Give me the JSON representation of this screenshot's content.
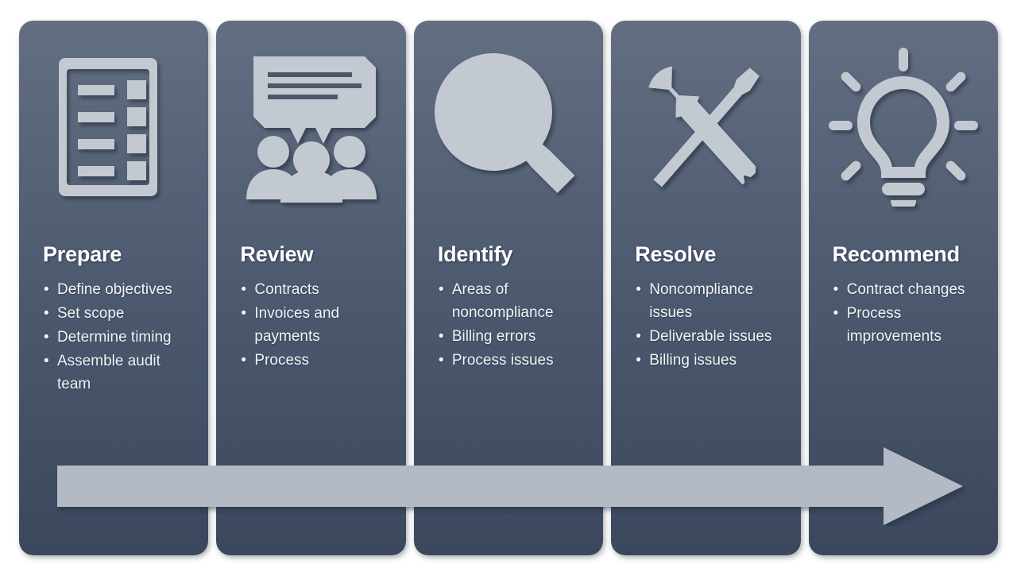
{
  "slide": {
    "background_color": "#ffffff",
    "card_gradient_top": "#636e81",
    "card_gradient_bottom": "#3a475d",
    "icon_color": "#c3c9d1",
    "text_color": "#f2f4f7",
    "title_color": "#ffffff",
    "arrow_color": "#b4bac4"
  },
  "process": {
    "steps": [
      {
        "id": "prepare",
        "title": "Prepare",
        "icon": "checklist-icon",
        "bullets": [
          "Define objectives",
          "Set scope",
          "Determine timing",
          "Assemble audit team"
        ]
      },
      {
        "id": "review",
        "title": "Review",
        "icon": "discussion-group-icon",
        "bullets": [
          "Contracts",
          "Invoices and payments",
          "Process"
        ]
      },
      {
        "id": "identify",
        "title": "Identify",
        "icon": "magnifying-glass-icon",
        "bullets": [
          "Areas of noncompliance",
          "Billing errors",
          "Process issues"
        ]
      },
      {
        "id": "resolve",
        "title": "Resolve",
        "icon": "tools-wrench-screwdriver-icon",
        "bullets": [
          "Noncompliance issues",
          "Deliverable issues",
          "Billing issues"
        ]
      },
      {
        "id": "recommend",
        "title": "Recommend",
        "icon": "lightbulb-icon",
        "bullets": [
          "Contract changes",
          "Process improvements"
        ]
      }
    ]
  },
  "flow_arrow": {
    "direction": "left-to-right",
    "name": "process-flow-arrow"
  }
}
